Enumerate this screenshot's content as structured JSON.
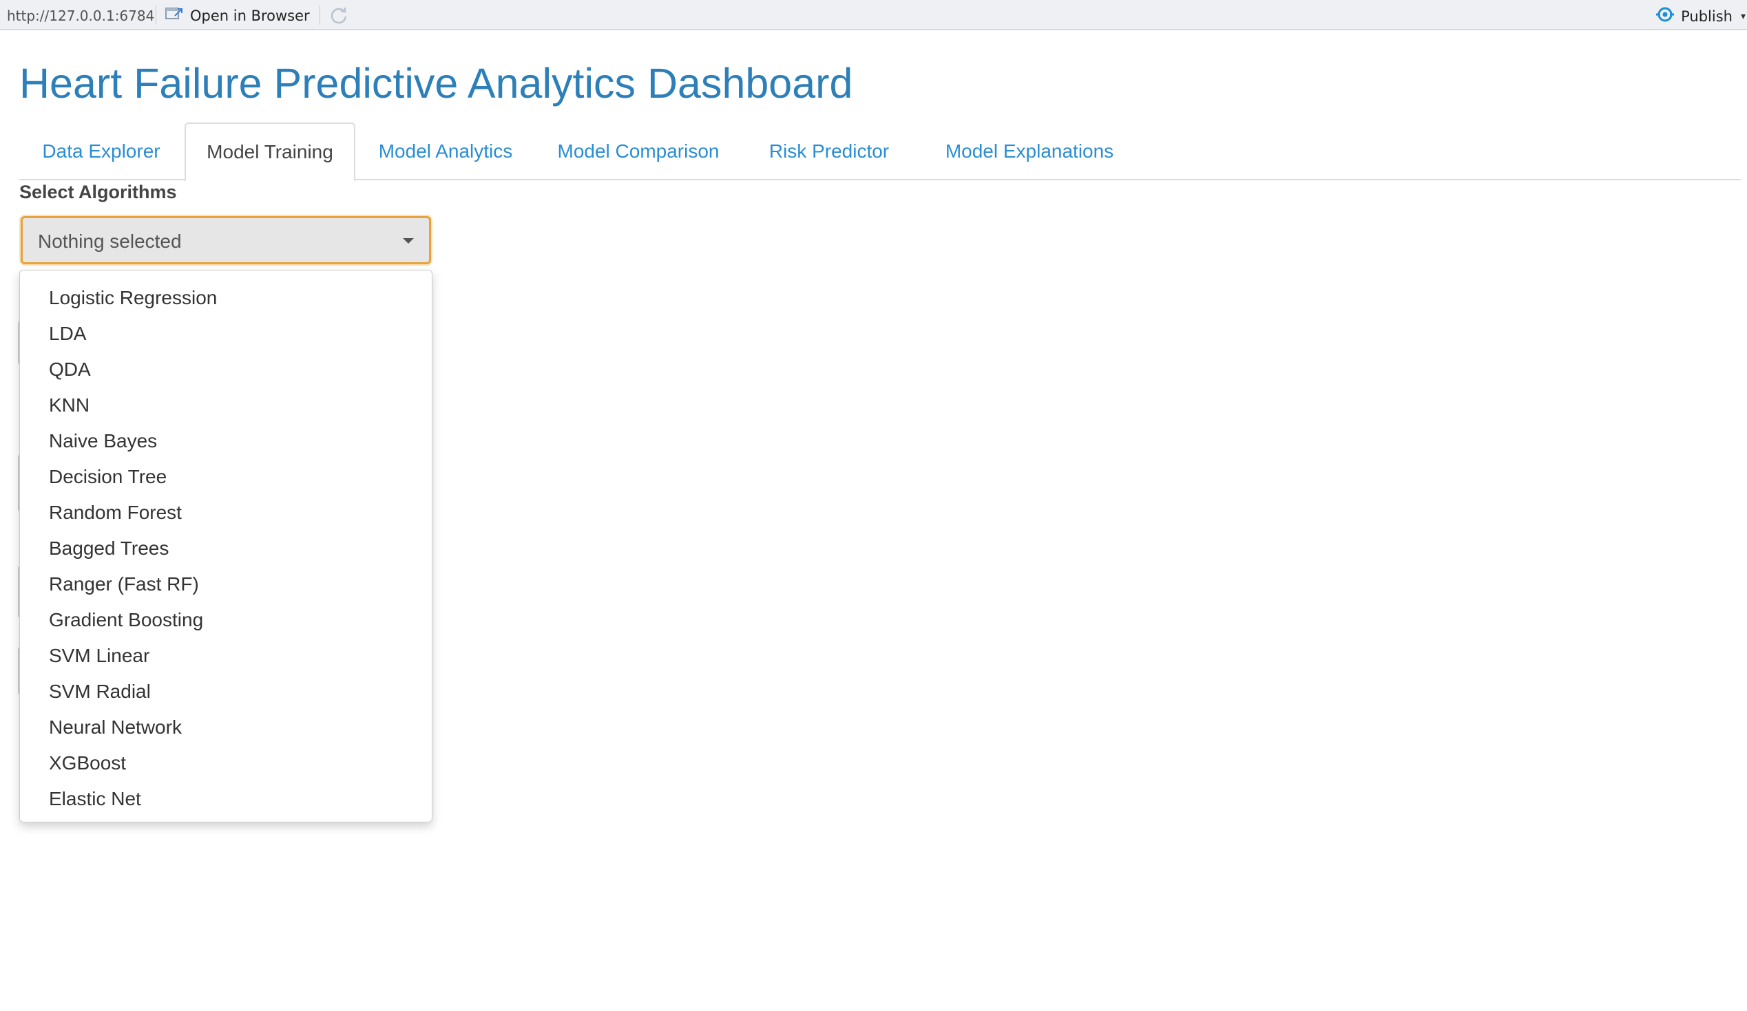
{
  "toolbar": {
    "url": "http://127.0.0.1:6784",
    "open_in_browser_label": "Open in Browser",
    "publish_label": "Publish",
    "icons": {
      "open_browser": "open-browser-icon",
      "refresh": "refresh-icon",
      "publish": "publish-icon"
    }
  },
  "page": {
    "title": "Heart Failure Predictive Analytics Dashboard"
  },
  "tabs": [
    {
      "label": "Data Explorer",
      "active": false
    },
    {
      "label": "Model Training",
      "active": true
    },
    {
      "label": "Model Analytics",
      "active": false
    },
    {
      "label": "Model Comparison",
      "active": false
    },
    {
      "label": "Risk Predictor",
      "active": false
    },
    {
      "label": "Model Explanations",
      "active": false
    }
  ],
  "algorithm_select": {
    "label": "Select Algorithms",
    "value": "Nothing selected",
    "options": [
      "Logistic Regression",
      "LDA",
      "QDA",
      "KNN",
      "Naive Bayes",
      "Decision Tree",
      "Random Forest",
      "Bagged Trees",
      "Ranger (Fast RF)",
      "Gradient Boosting",
      "SVM Linear",
      "SVM Radial",
      "Neural Network",
      "XGBoost",
      "Elastic Net"
    ]
  },
  "colors": {
    "title": "#2c7fb8",
    "tab_link": "#2a8dd4",
    "focus_border": "#e8a33d",
    "publish_icon": "#1a8fd6"
  }
}
